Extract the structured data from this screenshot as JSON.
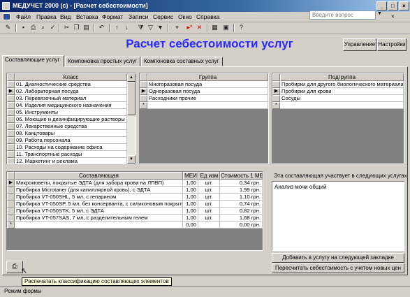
{
  "window": {
    "title": "МЕДУЧЕТ 2000 (c) - [Расчет себестоимости]",
    "btn_min": "_",
    "btn_max": "□",
    "btn_close": "×"
  },
  "menubar": {
    "items": [
      "Файл",
      "Правка",
      "Вид",
      "Вставка",
      "Формат",
      "Записи",
      "Сервис",
      "Окно",
      "Справка"
    ],
    "search_placeholder": "Введите вопрос"
  },
  "toolbar": {
    "icons": [
      "view-icon",
      "save-icon",
      "print-icon",
      "preview-icon",
      "spell-icon",
      "cut-icon",
      "copy-icon",
      "paste-icon",
      "undo-icon",
      "sort-asc-icon",
      "sort-desc-icon",
      "filter-icon",
      "find-icon",
      "new-record-icon",
      "delete-record-icon",
      "database-icon",
      "new-object-icon",
      "help-icon"
    ]
  },
  "header": {
    "title": "Расчет себестоимости услуг",
    "btn_manage": "Управление",
    "btn_settings": "Настройки"
  },
  "tabs": [
    {
      "label": "Составляющие услуг",
      "active": true
    },
    {
      "label": "Компоновка простых услуг",
      "active": false
    },
    {
      "label": "Компоновка составных услуг",
      "active": false
    }
  ],
  "class_grid": {
    "header": "Класс",
    "rows": [
      "01. Диагностические средства",
      "02. Лабораторная посуда",
      "03. Перевязочный материал",
      "04. Изделия медицинского назначения",
      "05. Инструменты",
      "06. Моющие и дезинфицирующие растворы",
      "07. Лекарственные средства",
      "08. Канцтовары",
      "09. Работа персонала",
      "10. Расходы на содержание офиса",
      "11. Транспортные расходы",
      "12. Маркетинг и реклама"
    ],
    "current_row": 1
  },
  "group_grid": {
    "header": "Группа",
    "rows": [
      "Многоразовая посуда",
      "Одноразовая посуда",
      "Расходники прочие"
    ],
    "current_row": 1
  },
  "subgroup_grid": {
    "header": "Подгруппа",
    "rows": [
      "Пробирки для другого биологического материала",
      "Пробирки для крови",
      "Сосуды"
    ],
    "current_row": 1
  },
  "components_grid": {
    "headers": [
      "Составляющая",
      "МЕИ",
      "Ед изм",
      "Стоимость 1 МЕИ"
    ],
    "rows": [
      [
        "Микрокюветы, покрытые ЭДТА (для забора крови на ЛПВП)",
        "1,00",
        "шт.",
        "0,34 грн."
      ],
      [
        "Пробирка Microtaner (для капиллярной кровь), с ЭДТА",
        "1,00",
        "шт.",
        "1,99 грн."
      ],
      [
        "Пробирка VT-050SHL, 5 мл, с гепарином",
        "1,00",
        "шт.",
        "1,10 грн."
      ],
      [
        "Пробирка VT-050SP, 5 мл, без консерванта, с силиконовым покрытием",
        "1,00",
        "шт.",
        "0,74 грн."
      ],
      [
        "Пробирка VT-050STK, 5 мл, с ЭДТА",
        "1,00",
        "шт.",
        "0,82 грн."
      ],
      [
        "Пробирка VT-057SAS, 7 мл, с разделительным гелем",
        "1,00",
        "шт.",
        "1,68 грн."
      ]
    ],
    "new_row": [
      "",
      "0,00",
      "",
      "0,00 грн."
    ],
    "current_row": 0
  },
  "usage": {
    "label": "Эта составляющая участвует в следующих услугах",
    "items": [
      "Анализ мочи общий"
    ]
  },
  "actions": {
    "add_button": "Добавить в услугу на следующей закладке",
    "recalc_button": "Пересчитать себестоимость с учетом новых цен"
  },
  "tooltip": "Распечатать классификацию составляющих элементов",
  "status": "Режим формы"
}
